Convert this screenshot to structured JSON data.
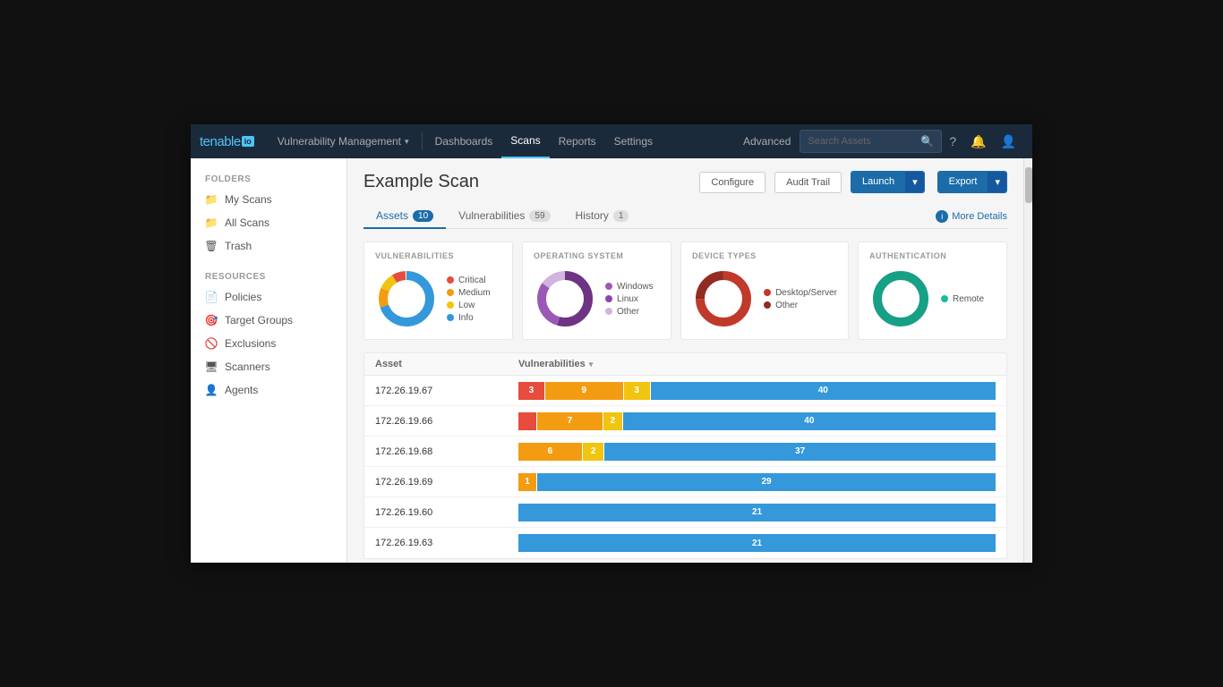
{
  "app": {
    "logo": "tenable",
    "logo_suffix": "io"
  },
  "nav": {
    "items": [
      {
        "label": "Vulnerability Management",
        "active": false,
        "has_arrow": true
      },
      {
        "label": "Dashboards",
        "active": false
      },
      {
        "label": "Scans",
        "active": true
      },
      {
        "label": "Reports",
        "active": false
      },
      {
        "label": "Settings",
        "active": false
      }
    ],
    "advanced_label": "Advanced",
    "search_placeholder": "Search Assets"
  },
  "sidebar": {
    "folders_label": "FOLDERS",
    "resources_label": "RESOURCES",
    "folders": [
      {
        "label": "My Scans",
        "icon": "📁",
        "active": false
      },
      {
        "label": "All Scans",
        "icon": "📁",
        "active": false
      },
      {
        "label": "Trash",
        "icon": "🗑",
        "active": false
      }
    ],
    "resources": [
      {
        "label": "Policies",
        "icon": "📄"
      },
      {
        "label": "Target Groups",
        "icon": "🎯"
      },
      {
        "label": "Exclusions",
        "icon": "🚫"
      },
      {
        "label": "Scanners",
        "icon": "🖥"
      },
      {
        "label": "Agents",
        "icon": "👤"
      }
    ]
  },
  "page": {
    "title": "Example Scan",
    "buttons": {
      "configure": "Configure",
      "audit_trail": "Audit Trail",
      "launch": "Launch",
      "export": "Export"
    }
  },
  "tabs": {
    "items": [
      {
        "label": "Assets",
        "count": "10",
        "active": true
      },
      {
        "label": "Vulnerabilities",
        "count": "59",
        "active": false
      },
      {
        "label": "History",
        "count": "1",
        "active": false
      }
    ],
    "more_details": "More Details"
  },
  "charts": [
    {
      "id": "vulnerabilities",
      "label": "VULNERABILITIES",
      "legend": [
        {
          "color": "#e74c3c",
          "text": "Critical"
        },
        {
          "color": "#f39c12",
          "text": "Medium"
        },
        {
          "color": "#f1c40f",
          "text": "Low"
        },
        {
          "color": "#3498db",
          "text": "Info"
        }
      ],
      "segments": [
        {
          "color": "#3498db",
          "pct": 70
        },
        {
          "color": "#f39c12",
          "pct": 12
        },
        {
          "color": "#f1c40f",
          "pct": 10
        },
        {
          "color": "#e74c3c",
          "pct": 8
        }
      ]
    },
    {
      "id": "os",
      "label": "OPERATING SYSTEM",
      "legend": [
        {
          "color": "#9b59b6",
          "text": "Windows"
        },
        {
          "color": "#8e44ad",
          "text": "Linux"
        },
        {
          "color": "#d2b4de",
          "text": "Other"
        }
      ],
      "segments": [
        {
          "color": "#6c3483",
          "pct": 55
        },
        {
          "color": "#9b59b6",
          "pct": 30
        },
        {
          "color": "#d2b4de",
          "pct": 15
        }
      ]
    },
    {
      "id": "device_types",
      "label": "DEVICE TYPES",
      "legend": [
        {
          "color": "#c0392b",
          "text": "Desktop/Server"
        },
        {
          "color": "#922b21",
          "text": "Other"
        }
      ],
      "segments": [
        {
          "color": "#c0392b",
          "pct": 75
        },
        {
          "color": "#922b21",
          "pct": 25
        }
      ]
    },
    {
      "id": "auth",
      "label": "AUTHENTICATION",
      "legend": [
        {
          "color": "#1abc9c",
          "text": "Remote"
        }
      ],
      "segments": [
        {
          "color": "#16a085",
          "pct": 100
        }
      ]
    }
  ],
  "table": {
    "col_asset": "Asset",
    "col_vuln": "Vulnerabilities",
    "rows": [
      {
        "asset": "172.26.19.67",
        "segs": [
          {
            "color": "#e74c3c",
            "val": "3",
            "flex": 3
          },
          {
            "color": "#f39c12",
            "val": "9",
            "flex": 9
          },
          {
            "color": "#f1c40f",
            "val": "3",
            "flex": 3
          },
          {
            "color": "#3498db",
            "val": "40",
            "flex": 40
          }
        ]
      },
      {
        "asset": "172.26.19.66",
        "segs": [
          {
            "color": "#e74c3c",
            "val": "",
            "flex": 1
          },
          {
            "color": "#f39c12",
            "val": "7",
            "flex": 7
          },
          {
            "color": "#f1c40f",
            "val": "2",
            "flex": 2
          },
          {
            "color": "#3498db",
            "val": "40",
            "flex": 40
          }
        ]
      },
      {
        "asset": "172.26.19.68",
        "segs": [
          {
            "color": "#f39c12",
            "val": "6",
            "flex": 6
          },
          {
            "color": "#f1c40f",
            "val": "2",
            "flex": 2
          },
          {
            "color": "#3498db",
            "val": "37",
            "flex": 37
          }
        ]
      },
      {
        "asset": "172.26.19.69",
        "segs": [
          {
            "color": "#f39c12",
            "val": "1",
            "flex": 1
          },
          {
            "color": "#3498db",
            "val": "29",
            "flex": 29
          }
        ]
      },
      {
        "asset": "172.26.19.60",
        "segs": [
          {
            "color": "#3498db",
            "val": "21",
            "flex": 21
          }
        ]
      },
      {
        "asset": "172.26.19.63",
        "segs": [
          {
            "color": "#3498db",
            "val": "21",
            "flex": 21
          }
        ]
      }
    ]
  },
  "colors": {
    "accent_blue": "#1b6ca8",
    "nav_bg": "#1b2a3b"
  }
}
